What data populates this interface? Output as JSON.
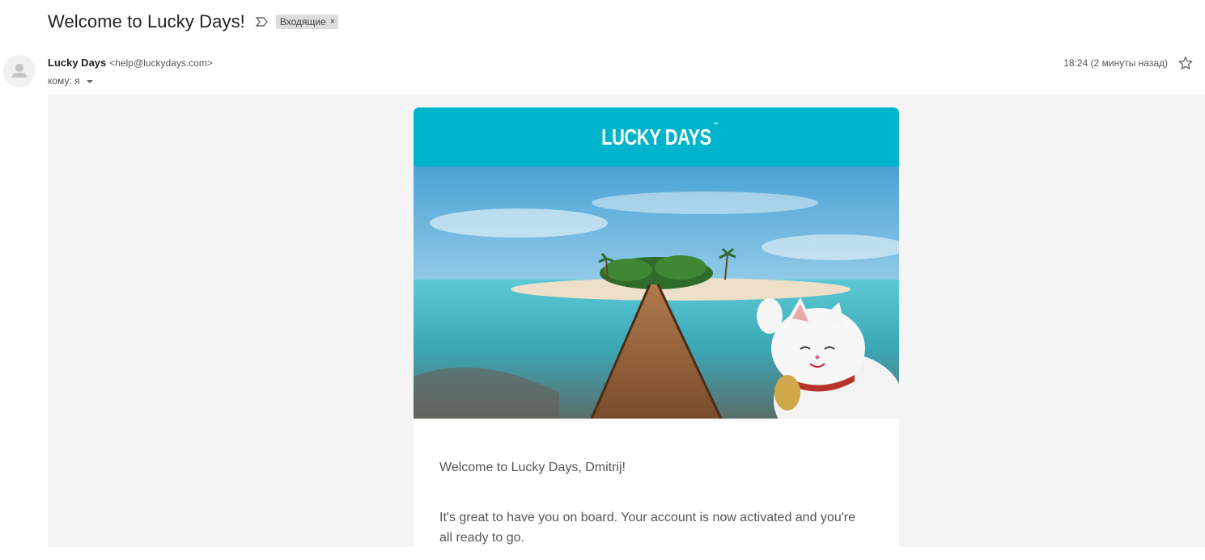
{
  "email": {
    "subject": "Welcome to Lucky Days!",
    "label": "Входящие",
    "label_remove": "×",
    "sender_name": "Lucky Days",
    "sender_email": "<help@luckydays.com>",
    "recipient": "кому: я",
    "time": "18:24 (2 минуты назад)"
  },
  "message": {
    "brand_logo": "LUCKY DAYS",
    "brand_tm": "™",
    "greeting": "Welcome to Lucky Days, Dmitrij!",
    "paragraph1": "It's great to have you on board. Your account is now activated and you're all ready to go."
  },
  "colors": {
    "brand": "#00b4cc",
    "body_bg": "#f4f4f4"
  },
  "icons": {
    "important": "important-marker-icon",
    "star": "star-icon",
    "avatar": "avatar-icon",
    "dropdown": "chevron-down-icon"
  }
}
